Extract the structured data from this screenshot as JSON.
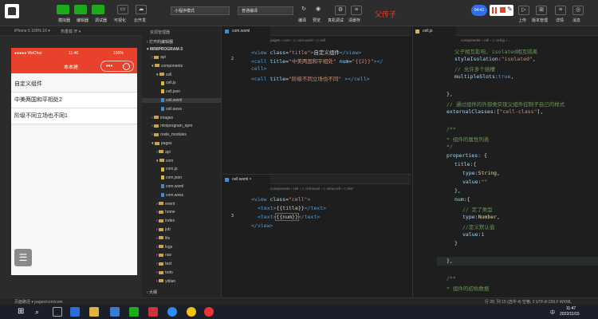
{
  "toolbar": {
    "buttons": [
      "模拟器",
      "编辑器",
      "调试器",
      "可视化",
      "云开发"
    ],
    "mode": "小程序模式",
    "compile": "普通编译",
    "actions": [
      "编译",
      "预览",
      "真机调试",
      "清缓存"
    ],
    "right_actions": [
      "上传",
      "版本管理",
      "详情",
      "消息"
    ],
    "annotation": "父传子",
    "avatar_badge": "04:41"
  },
  "sim": {
    "device": "iPhone 5 100% 16 ▾",
    "hotreload": "热重载 开 ▾",
    "carrier": "●●●●● WeChat",
    "wifi": "令",
    "time": "11:46",
    "battery": "100%",
    "title": "本本建",
    "rows": [
      "自定义组件",
      "中美两国和平相处2",
      "阶级不同立场也不同1"
    ]
  },
  "explorer": {
    "title": "资源管理器",
    "open_editors": "› 打开的编辑器",
    "project": "▾ MINIPROGRAM-3",
    "items": [
      {
        "name": "api",
        "type": "folder",
        "indent": 1
      },
      {
        "name": "components",
        "type": "folder",
        "indent": 1,
        "open": true
      },
      {
        "name": "cell",
        "type": "folder",
        "indent": 2,
        "open": true
      },
      {
        "name": "cell.js",
        "type": "js",
        "indent": 3
      },
      {
        "name": "cell.json",
        "type": "json",
        "indent": 3
      },
      {
        "name": "cell.wxml",
        "type": "wxml",
        "indent": 3,
        "selected": true
      },
      {
        "name": "cell.wxss",
        "type": "wxss",
        "indent": 3
      },
      {
        "name": "images",
        "type": "folder",
        "indent": 1
      },
      {
        "name": "miniprogram_npm",
        "type": "folder",
        "indent": 1
      },
      {
        "name": "node_modules",
        "type": "folder",
        "indent": 1
      },
      {
        "name": "pages",
        "type": "folder",
        "indent": 1,
        "open": true
      },
      {
        "name": "api",
        "type": "folder",
        "indent": 2
      },
      {
        "name": "com",
        "type": "folder",
        "indent": 2,
        "open": true
      },
      {
        "name": "com.js",
        "type": "js",
        "indent": 3
      },
      {
        "name": "com.json",
        "type": "json",
        "indent": 3
      },
      {
        "name": "com.wxml",
        "type": "wxml",
        "indent": 3
      },
      {
        "name": "com.wxss",
        "type": "wxss",
        "indent": 3
      },
      {
        "name": "event",
        "type": "folder",
        "indent": 2
      },
      {
        "name": "home",
        "type": "folder",
        "indent": 2
      },
      {
        "name": "index",
        "type": "folder",
        "indent": 2
      },
      {
        "name": "job",
        "type": "folder",
        "indent": 2
      },
      {
        "name": "lits",
        "type": "folder",
        "indent": 2
      },
      {
        "name": "logs",
        "type": "folder",
        "indent": 2
      },
      {
        "name": "nav",
        "type": "folder",
        "indent": 2
      },
      {
        "name": "test",
        "type": "folder",
        "indent": 2
      },
      {
        "name": "todo",
        "type": "folder",
        "indent": 2
      },
      {
        "name": "yidian",
        "type": "folder",
        "indent": 2
      }
    ],
    "outline": "› 大纲"
  },
  "editor1": {
    "tab": "com.wxml",
    "breadcrumb": "pages › com › ◇ com.wxml › ◇ cell",
    "lines": [
      "",
      "2",
      "",
      "",
      "",
      "",
      "",
      "",
      "",
      "",
      "",
      "",
      "",
      "",
      "",
      "",
      "",
      "",
      ""
    ]
  },
  "editor2": {
    "tab": "cell.wxml",
    "breadcrumb": "components › cell › ◇ cell.wxml › ◇ view.cell › ◇ text",
    "lines": [
      "",
      "",
      "3",
      "",
      "",
      "",
      "",
      "",
      "",
      ""
    ]
  },
  "editor3": {
    "tab": "cell.js",
    "breadcrumb": "components › cell › ◇ cell.js › ..."
  },
  "statusbar": {
    "left": "页面路径 ▾  pages/com/com",
    "right": "行 28, 列 15 (选中 4)  空格: 2  UTF-8  CRLF  WXML"
  },
  "taskbar": {
    "time": "11:47",
    "date": "2022/11/15",
    "ime": "中"
  }
}
